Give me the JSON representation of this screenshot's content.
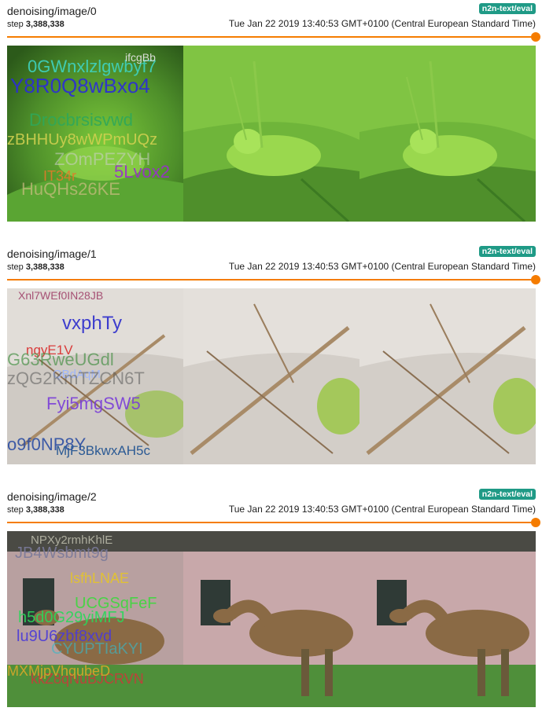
{
  "cards": [
    {
      "title": "denoising/image/0",
      "tag": "n2n-text/eval",
      "step_label": "step",
      "step_value": "3,388,338",
      "timestamp": "Tue Jan 22 2019 13:40:53 GMT+0100 (Central European Standard Time)",
      "noise_text": [
        "0GWnxlzlgwbyf7",
        "Y8R0Q8wBxo4",
        "Drocbrsisvwd",
        "zBHHUy8wWPmUQz",
        "ZOmPEZYH",
        "IT34r",
        "5Lvox2",
        "HuQHs26KE",
        "ifcgBb"
      ]
    },
    {
      "title": "denoising/image/1",
      "tag": "n2n-text/eval",
      "step_label": "step",
      "step_value": "3,388,338",
      "timestamp": "Tue Jan 22 2019 13:40:53 GMT+0100 (Central European Standard Time)",
      "noise_text": [
        "Xnl7WEf0IN28JB",
        "vxphTy",
        "ngyE1V",
        "QBdAqM",
        "zQG2KmTZCN6T",
        "Fyi5mgSW5",
        "o9f0NP8Y",
        "MjF3BkwxAH5c",
        "G63RweUGdl"
      ]
    },
    {
      "title": "denoising/image/2",
      "tag": "n2n-text/eval",
      "step_label": "step",
      "step_value": "3,388,338",
      "timestamp": "Tue Jan 22 2019 13:40:53 GMT+0100 (Central European Standard Time)",
      "noise_text": [
        "NPXy2rmhKhlE",
        "JB4Wsbmt9g",
        "lsfhLNAE",
        "UCGSqFeF",
        "h5d0G29yiMFJ",
        "lu9U6zbf8xvd",
        "CYUPTIaKYI",
        "kkZ8qNuBJCRVN",
        "MXMjpVhqubeD"
      ]
    }
  ],
  "colors": {
    "tag_bg": "#1f9a86",
    "slider": "#f57c00"
  }
}
